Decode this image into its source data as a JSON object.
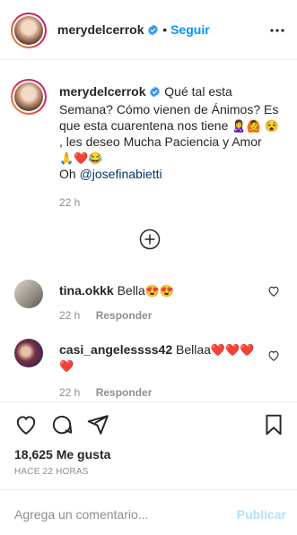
{
  "header": {
    "username": "merydelcerrok",
    "separator": "•",
    "follow_label": "Seguir"
  },
  "caption": {
    "username": "merydelcerrok",
    "text_1": "Qué tal esta Semana? Cómo vienen de Ánimos? Es que esta cuarentena nos tiene",
    "emojis_1": "🙎‍♀️🙆",
    "emoji_2": "😵",
    "text_2": ", les deseo Mucha Paciencia y Amor",
    "emojis_3": "🙏❤️😂",
    "text_3": "Oh",
    "mention": "@josefinabietti",
    "time": "22 h"
  },
  "comments": [
    {
      "username": "tina.okkk",
      "text": "Bella",
      "emojis": "😍😍",
      "time": "22 h",
      "reply_label": "Responder"
    },
    {
      "username": "casi_angelessss42",
      "text": "Bellaa",
      "emojis": "❤️❤️❤️",
      "emojis_2": "❤️",
      "time": "22 h",
      "reply_label": "Responder"
    }
  ],
  "stats": {
    "likes": "18,625 Me gusta",
    "ago": "HACE 22 HORAS"
  },
  "add_comment": {
    "placeholder": "Agrega un comentario...",
    "post_label": "Publicar"
  },
  "colors": {
    "link_blue": "#0095f6",
    "muted": "#8e8e8e",
    "post_disabled": "#b2dffc",
    "heart_red": "#ed4956"
  },
  "icons": [
    "more-icon",
    "verified-icon",
    "add-circle-icon",
    "heart-icon",
    "comment-icon",
    "share-icon",
    "bookmark-icon"
  ]
}
